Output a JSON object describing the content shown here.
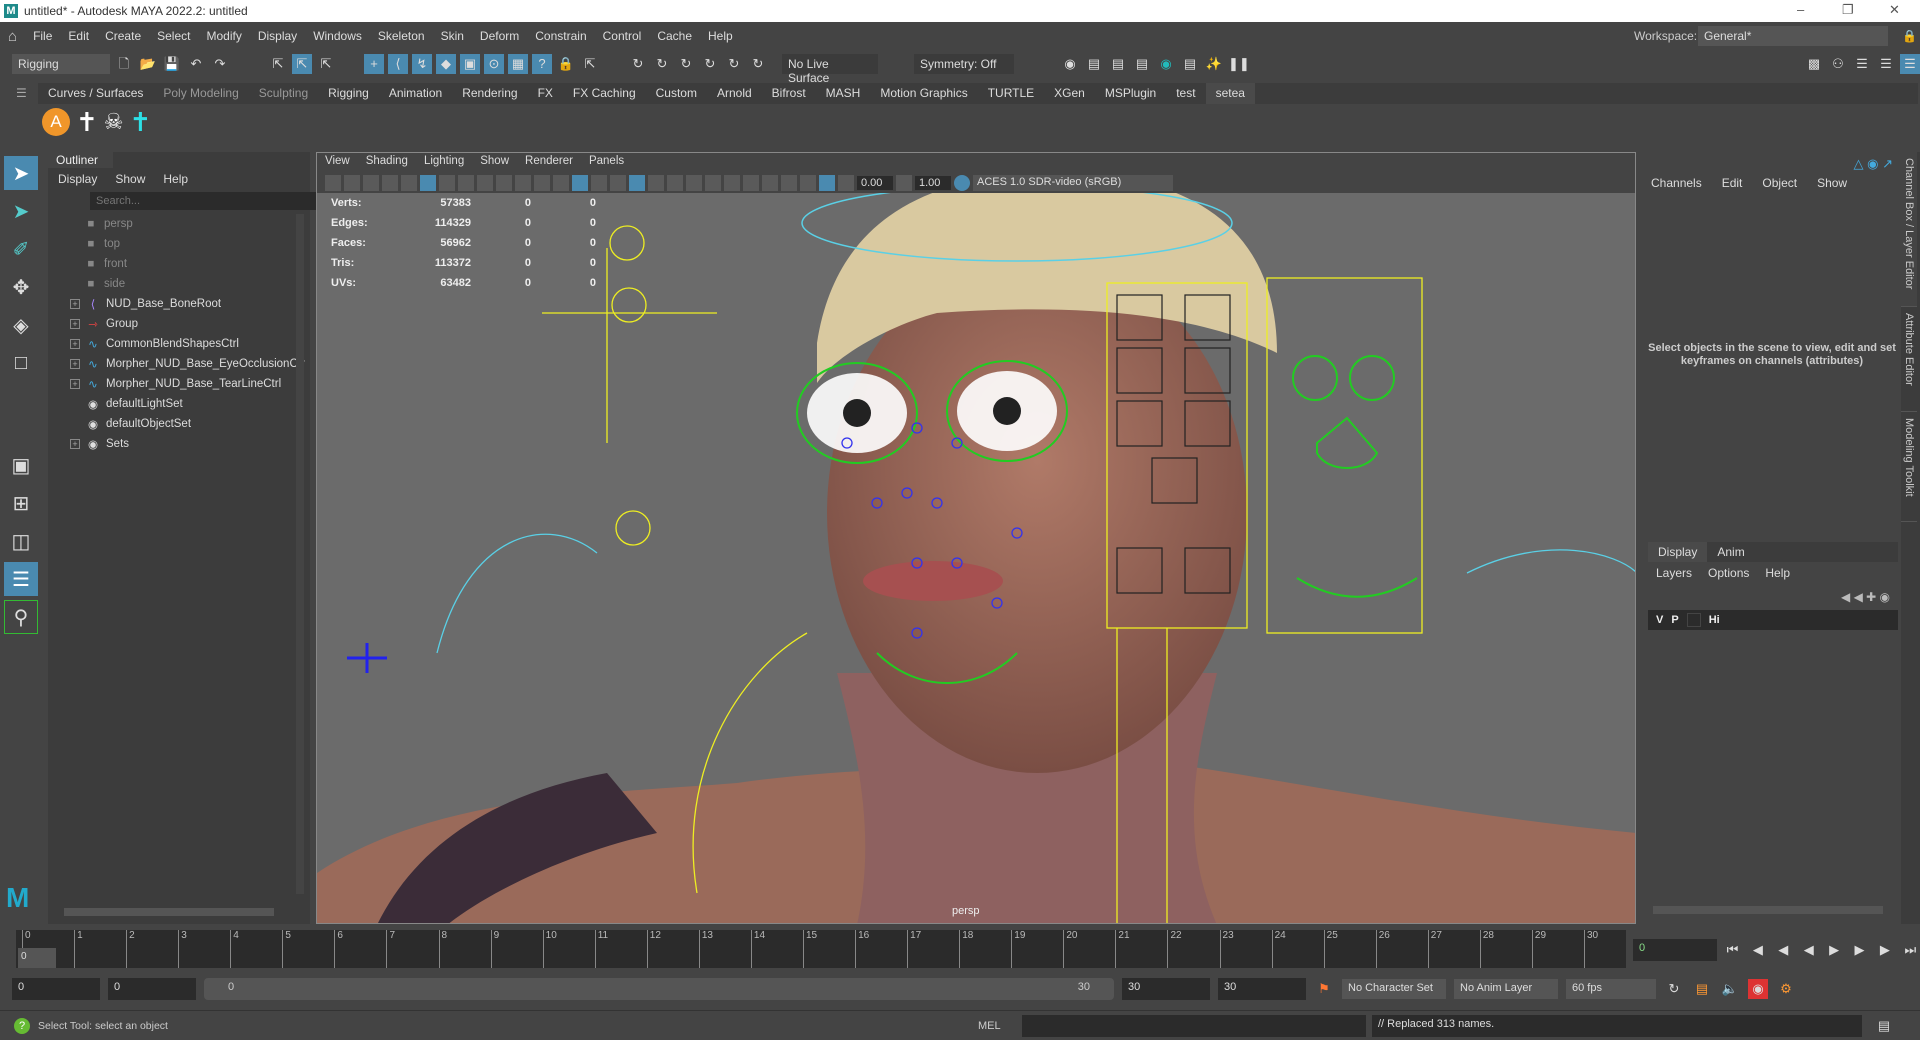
{
  "window": {
    "title": "untitled* - Autodesk MAYA 2022.2: untitled",
    "logo": "M"
  },
  "menubar": [
    "File",
    "Edit",
    "Create",
    "Select",
    "Modify",
    "Display",
    "Windows",
    "Skeleton",
    "Skin",
    "Deform",
    "Constrain",
    "Control",
    "Cache",
    "Help"
  ],
  "workspace": {
    "label": "Workspace:",
    "value": "General*"
  },
  "statusline": {
    "menuset": "Rigging",
    "live_surface": "No Live Surface",
    "symmetry": "Symmetry: Off"
  },
  "shelf": {
    "tabs": [
      "Curves / Surfaces",
      "Poly Modeling",
      "Sculpting",
      "Rigging",
      "Animation",
      "Rendering",
      "FX",
      "FX Caching",
      "Custom",
      "Arnold",
      "Bifrost",
      "MASH",
      "Motion Graphics",
      "TURTLE",
      "XGen",
      "MSPlugin",
      "test",
      "setea"
    ],
    "active": "setea"
  },
  "outliner": {
    "title": "Outliner",
    "menu": [
      "Display",
      "Show",
      "Help"
    ],
    "search_placeholder": "Search...",
    "items": [
      {
        "name": "persp",
        "type": "camera"
      },
      {
        "name": "top",
        "type": "camera"
      },
      {
        "name": "front",
        "type": "camera"
      },
      {
        "name": "side",
        "type": "camera"
      },
      {
        "name": "NUD_Base_BoneRoot",
        "type": "joint"
      },
      {
        "name": "Group",
        "type": "group"
      },
      {
        "name": "CommonBlendShapesCtrl",
        "type": "curve"
      },
      {
        "name": "Morpher_NUD_Base_EyeOcclusionCtr",
        "type": "curve"
      },
      {
        "name": "Morpher_NUD_Base_TearLineCtrl",
        "type": "curve"
      },
      {
        "name": "defaultLightSet",
        "type": "set"
      },
      {
        "name": "defaultObjectSet",
        "type": "set"
      },
      {
        "name": "Sets",
        "type": "set"
      }
    ]
  },
  "viewport": {
    "menu": [
      "View",
      "Shading",
      "Lighting",
      "Show",
      "Renderer",
      "Panels"
    ],
    "exposure": "0.00",
    "gamma": "1.00",
    "color_space": "ACES 1.0 SDR-video (sRGB)",
    "camera": "persp",
    "hud": [
      {
        "label": "Verts:",
        "value": "57383",
        "a": "0",
        "b": "0"
      },
      {
        "label": "Edges:",
        "value": "114329",
        "a": "0",
        "b": "0"
      },
      {
        "label": "Faces:",
        "value": "56962",
        "a": "0",
        "b": "0"
      },
      {
        "label": "Tris:",
        "value": "113372",
        "a": "0",
        "b": "0"
      },
      {
        "label": "UVs:",
        "value": "63482",
        "a": "0",
        "b": "0"
      }
    ]
  },
  "channelbox": {
    "menu": [
      "Channels",
      "Edit",
      "Object",
      "Show"
    ],
    "message": "Select objects in the scene to view, edit and set keyframes on channels (attributes)"
  },
  "layers": {
    "tabs": [
      "Display",
      "Anim"
    ],
    "menu": [
      "Layers",
      "Options",
      "Help"
    ],
    "row": {
      "v": "V",
      "p": "P",
      "name": "Hi"
    }
  },
  "side_tabs": [
    "Channel Box / Layer Editor",
    "Attribute Editor",
    "Modeling Toolkit"
  ],
  "timeline": {
    "ticks": [
      "0",
      "1",
      "2",
      "3",
      "4",
      "5",
      "6",
      "7",
      "8",
      "9",
      "10",
      "11",
      "12",
      "13",
      "14",
      "15",
      "16",
      "17",
      "18",
      "19",
      "20",
      "21",
      "22",
      "23",
      "24",
      "25",
      "26",
      "27",
      "28",
      "29",
      "30"
    ],
    "current": "0",
    "current_field": "0"
  },
  "range": {
    "start": "0",
    "anim_start": "0",
    "slider_start": "0",
    "slider_end": "30",
    "end": "30",
    "anim_end": "30",
    "character_set": "No Character Set",
    "anim_layer": "No Anim Layer",
    "fps": "60 fps"
  },
  "status": {
    "help": "Select Tool: select an object",
    "lang": "MEL",
    "result": "// Replaced 313 names."
  }
}
